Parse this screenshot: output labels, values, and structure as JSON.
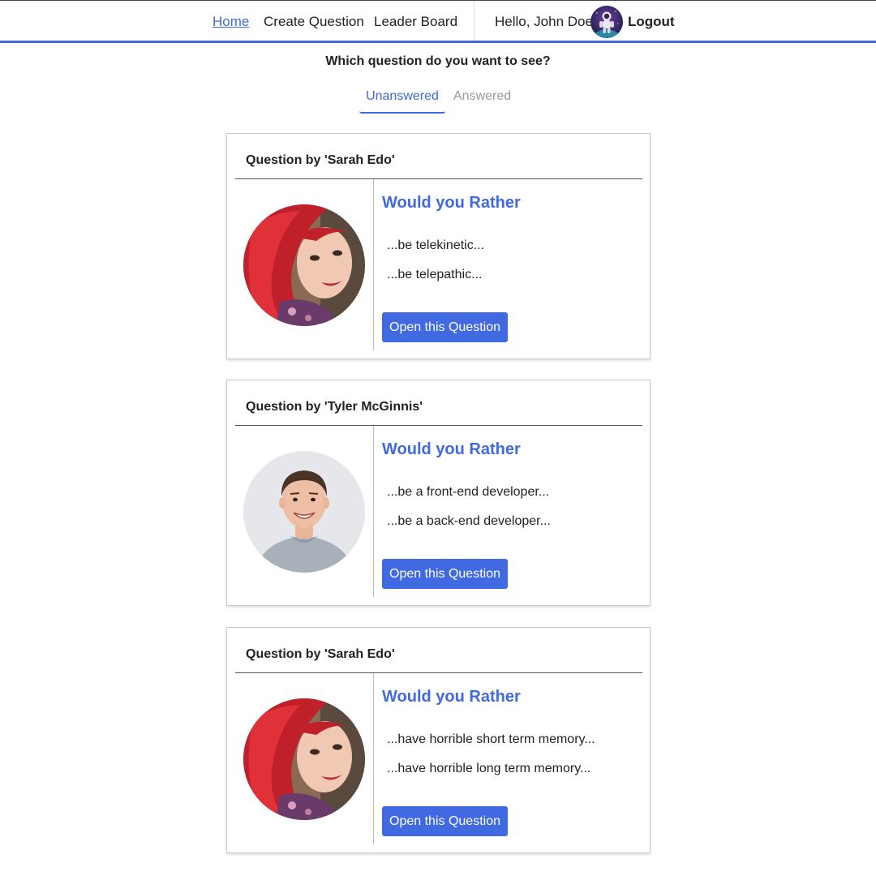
{
  "nav": {
    "links": [
      "Home",
      "Create Question",
      "Leader Board"
    ],
    "greeting": "Hello, John Doe",
    "logout": "Logout",
    "active_link": "Home",
    "accent_color": "#4169e1"
  },
  "page": {
    "heading": "Which question do you want to see?",
    "tabs": [
      "Unanswered",
      "Answered"
    ],
    "active_tab": "Unanswered"
  },
  "questions": [
    {
      "author_label": "Question by 'Sarah Edo'",
      "title": "Would you Rather",
      "option_one": "...be telekinetic...",
      "option_two": "...be telepathic...",
      "button": "Open this Question",
      "avatar": "red-haired-woman-avatar"
    },
    {
      "author_label": "Question by 'Tyler McGinnis'",
      "title": "Would you Rather",
      "option_one": "...be a front-end developer...",
      "option_two": "...be a back-end developer...",
      "button": "Open this Question",
      "avatar": "smiling-man-avatar"
    },
    {
      "author_label": "Question by 'Sarah Edo'",
      "title": "Would you Rather",
      "option_one": "...have horrible short term memory...",
      "option_two": "...have horrible long term memory...",
      "button": "Open this Question",
      "avatar": "red-haired-woman-avatar"
    }
  ]
}
